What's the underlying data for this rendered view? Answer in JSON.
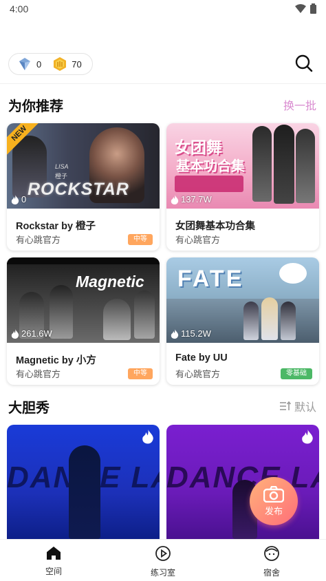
{
  "status": {
    "time": "4:00"
  },
  "header": {
    "diamond_count": "0",
    "coin_count": "70",
    "search_icon": "search-icon"
  },
  "recommend": {
    "title": "为你推荐",
    "refresh_label": "换一批",
    "cards": [
      {
        "title": "Rockstar by 橙子",
        "author": "有心跳官方",
        "plays": "0",
        "badge": "中等",
        "badge_color": "#ffa65e",
        "thumb_text": "ROCKSTAR",
        "thumb_small": "LISA",
        "thumb_small2": "橙子",
        "is_new": true,
        "new_label": "NEW"
      },
      {
        "title": "女团舞基本功合集",
        "author": "有心跳官方",
        "plays": "137.7W",
        "badge": "",
        "badge_color": "",
        "thumb_text": "女团舞",
        "thumb_small": "基本功合集",
        "is_new": false
      },
      {
        "title": "Magnetic by 小方",
        "author": "有心跳官方",
        "plays": "261.6W",
        "badge": "中等",
        "badge_color": "#ffa65e",
        "thumb_text": "Magnetic",
        "is_new": false
      },
      {
        "title": "Fate by UU",
        "author": "有心跳官方",
        "plays": "115.2W",
        "badge": "零基础",
        "badge_color": "#4cb866",
        "thumb_text": "FATE",
        "is_new": false
      }
    ]
  },
  "show": {
    "title": "大胆秀",
    "sort_label": "默认",
    "cards": [
      {
        "thumb_text": "DANCE LA"
      },
      {
        "thumb_text": "DANCE LA"
      }
    ]
  },
  "fab": {
    "label": "发布"
  },
  "nav": {
    "items": [
      {
        "label": "空间",
        "icon": "home-icon"
      },
      {
        "label": "练习室",
        "icon": "play-icon"
      },
      {
        "label": "宿舍",
        "icon": "face-icon"
      }
    ]
  },
  "colors": {
    "accent_pink": "#d98bd0",
    "badge_orange": "#ffa65e",
    "badge_green": "#4cb866",
    "fab_start": "#ffb27a",
    "fab_end": "#ff6e79"
  }
}
